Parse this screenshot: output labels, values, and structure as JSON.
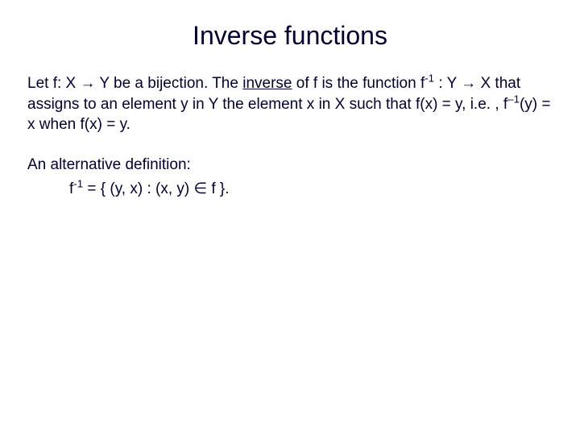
{
  "title": "Inverse functions",
  "p1": {
    "t1": "Let  f: X → Y be a bijection.  The ",
    "inverse": "inverse",
    "t2": " of f is the function f",
    "sup1": "-1",
    "t3": "  : Y → X that assigns to an element y in Y the element x in X such that f(x) = y, i.e. , f",
    "sup2": "–1",
    "t4": "(y) = x when f(x) = y."
  },
  "p2": "An alternative definition:",
  "p3": {
    "t1": "f",
    "sup": "-1",
    "t2": " = { (y, x) : (x, y) ∈ f }."
  }
}
